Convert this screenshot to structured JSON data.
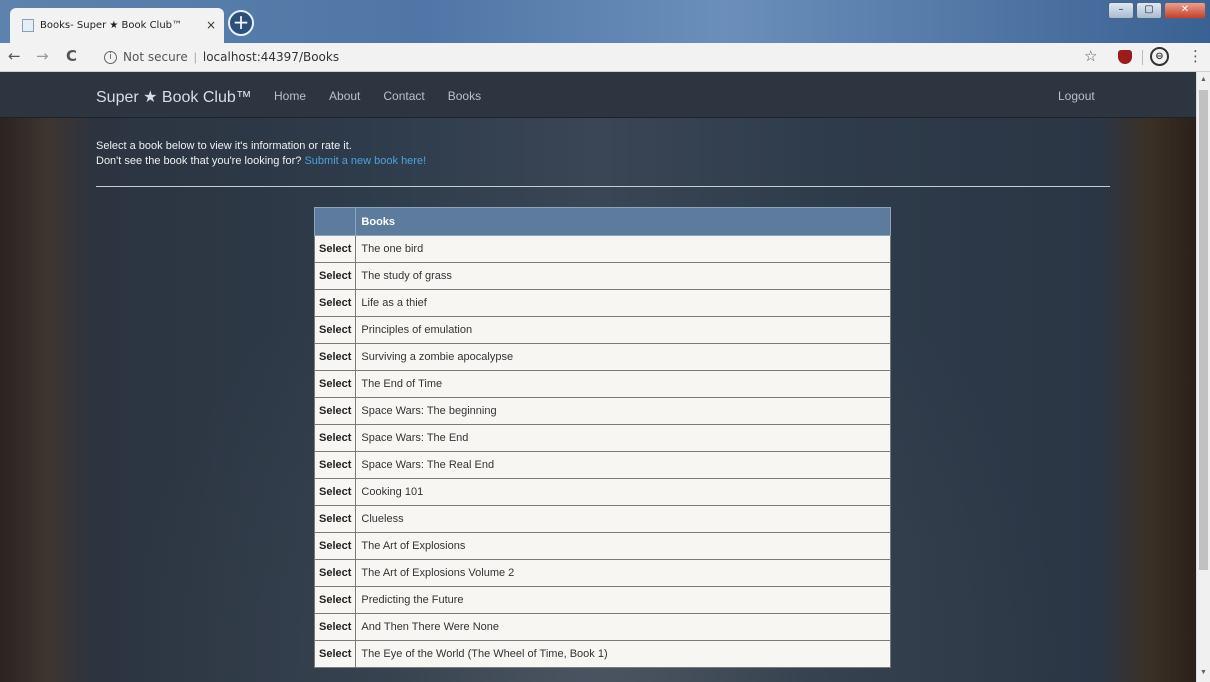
{
  "browser": {
    "tab_title": "Books- Super ★ Book Club™",
    "tab_close": "×",
    "new_tab": "+",
    "window_buttons": {
      "minimize": "–",
      "maximize": "▢",
      "close": "✕"
    },
    "nav": {
      "back": "←",
      "forward": "→",
      "reload": "C"
    },
    "security_label": "Not secure",
    "url": "localhost:44397/Books",
    "bookmark_star": "☆",
    "menu": "⋮"
  },
  "site": {
    "brand": "Super ★ Book Club™",
    "nav_links": [
      "Home",
      "About",
      "Contact",
      "Books"
    ],
    "logout": "Logout"
  },
  "intro": {
    "line1": "Select a book below to view it's information or rate it.",
    "line2_prefix": "Don't see the book that you're looking for?",
    "line2_link": "Submit a new book here!"
  },
  "table": {
    "columns": [
      "",
      "Books"
    ],
    "select_label": "Select",
    "rows": [
      "The one bird",
      "The study of grass",
      "Life as a thief",
      "Principles of emulation",
      "Surviving a zombie apocalypse",
      "The End of Time",
      "Space Wars: The beginning",
      "Space Wars: The End",
      "Space Wars: The Real End",
      "Cooking 101",
      "Clueless",
      "The Art of Explosions",
      "The Art of Explosions Volume 2",
      "Predicting the Future",
      "And Then There Were None",
      "The Eye of the World (The Wheel of Time, Book 1)"
    ]
  }
}
